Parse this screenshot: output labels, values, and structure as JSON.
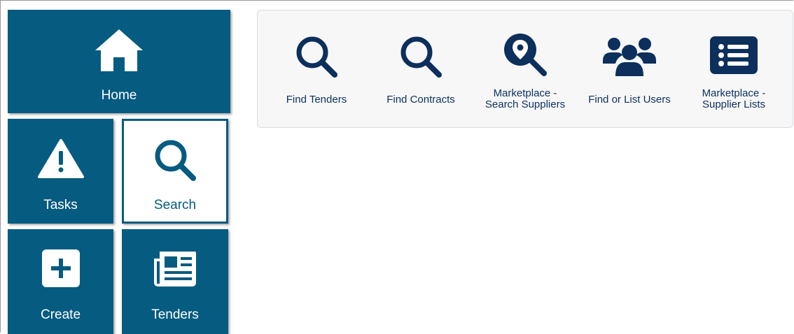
{
  "tiles": {
    "home": {
      "label": "Home",
      "icon": "home-icon"
    },
    "tasks": {
      "label": "Tasks",
      "icon": "warning-icon"
    },
    "search": {
      "label": "Search",
      "icon": "search-icon",
      "active": true
    },
    "create": {
      "label": "Create",
      "icon": "plus-square-icon"
    },
    "tenders": {
      "label": "Tenders",
      "icon": "newspaper-icon"
    }
  },
  "search_menu": {
    "items": [
      {
        "label": "Find Tenders",
        "icon": "search-icon"
      },
      {
        "label": "Find Contracts",
        "icon": "search-icon"
      },
      {
        "label": "Marketplace -\nSearch Suppliers",
        "line1": "Marketplace -",
        "line2": "Search Suppliers",
        "icon": "location-search-icon"
      },
      {
        "label": "Find or List Users",
        "icon": "users-icon"
      },
      {
        "label": "Marketplace -\nSupplier Lists",
        "line1": "Marketplace -",
        "line2": "Supplier Lists",
        "icon": "list-icon"
      }
    ]
  },
  "colors": {
    "tile_bg": "#065b80",
    "tile_text": "#ffffff",
    "sub_icon": "#0c2f5c",
    "panel_bg": "#f7f7f8"
  }
}
